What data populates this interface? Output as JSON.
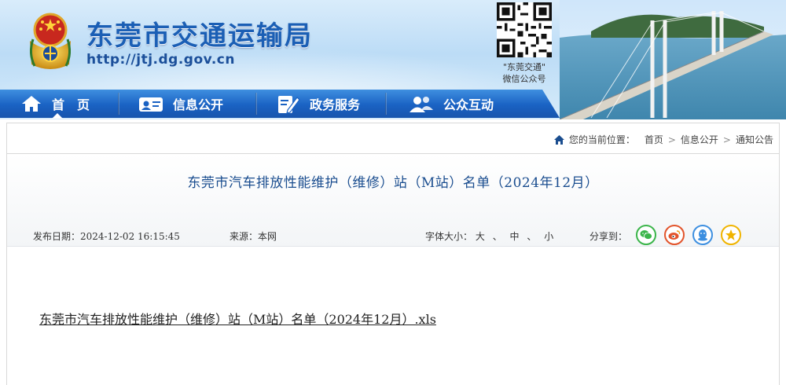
{
  "site": {
    "title": "东莞市交通运输局",
    "url": "http://jtj.dg.gov.cn",
    "qr_caption_line1": "\"东莞交通\"",
    "qr_caption_line2": "微信公众号"
  },
  "nav": {
    "items": [
      {
        "label": "首　页",
        "icon": "home-icon"
      },
      {
        "label": "信息公开",
        "icon": "info-card-icon"
      },
      {
        "label": "政务服务",
        "icon": "edit-document-icon"
      },
      {
        "label": "公众互动",
        "icon": "people-icon"
      }
    ]
  },
  "breadcrumb": {
    "prefix": "您的当前位置：",
    "items": [
      "首页",
      "信息公开",
      "通知公告"
    ],
    "separator": ">"
  },
  "article": {
    "title": "东莞市汽车排放性能维护（维修）站（M站）名单（2024年12月）",
    "publish_label": "发布日期：",
    "publish_date": "2024-12-02 16:15:45",
    "source_label": "来源：",
    "source": "本网",
    "font_size_label": "字体大小：",
    "font_sizes": [
      "大",
      "中",
      "小"
    ],
    "font_size_sep": "、",
    "share_label": "分享到：",
    "share_targets": [
      "wechat-icon",
      "weibo-icon",
      "qq-icon",
      "qzone-icon"
    ],
    "attachment": "东莞市汽车排放性能维护（维修）站（M站）名单（2024年12月）.xls"
  },
  "colors": {
    "nav_blue": "#1a62c3",
    "title_blue": "#1a4d8f",
    "wechat": "#3bb54a",
    "weibo": "#e2542b",
    "qq": "#3d8fe0",
    "qzone": "#f0b400"
  }
}
